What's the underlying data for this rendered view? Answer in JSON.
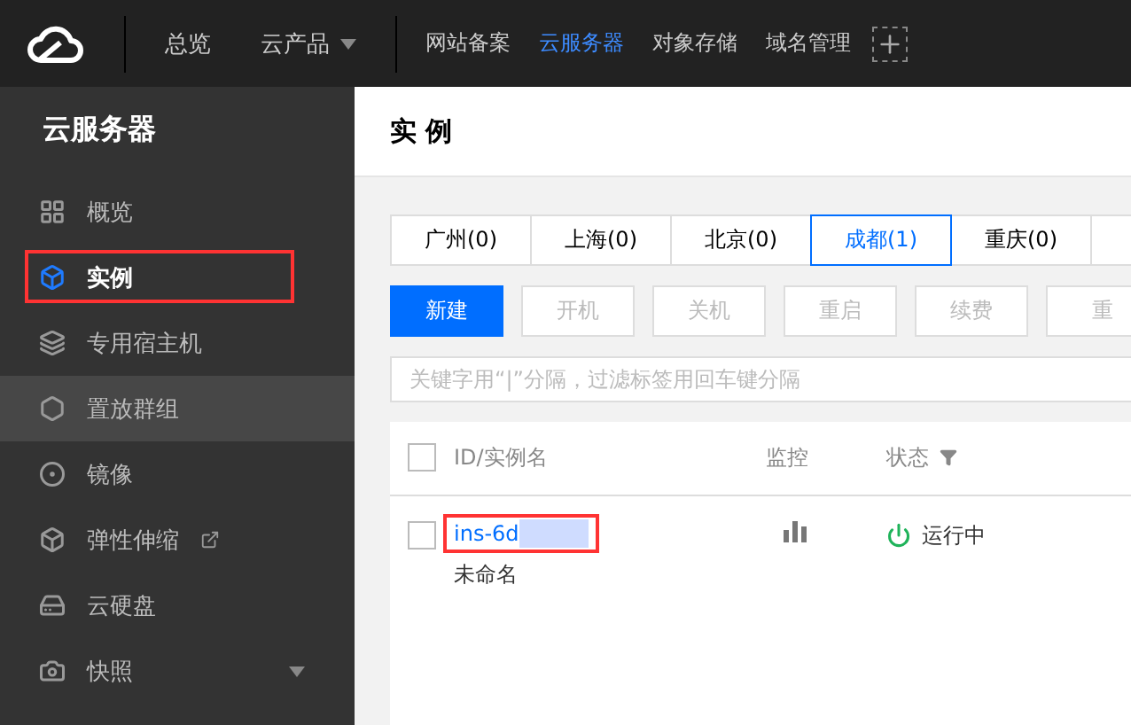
{
  "top_nav": {
    "items": [
      {
        "label": "总览",
        "dropdown": false
      },
      {
        "label": "云产品",
        "dropdown": true
      }
    ],
    "links": [
      {
        "label": "网站备案",
        "selected": false
      },
      {
        "label": "云服务器",
        "selected": true
      },
      {
        "label": "对象存储",
        "selected": false
      },
      {
        "label": "域名管理",
        "selected": false
      }
    ]
  },
  "sidebar": {
    "title": "云服务器",
    "items": [
      {
        "label": "概览",
        "kind": "grid",
        "selected": false,
        "hovered": false,
        "highlighted": false,
        "external": false,
        "expandable": false
      },
      {
        "label": "实例",
        "kind": "cube",
        "selected": true,
        "hovered": false,
        "highlighted": true,
        "external": false,
        "expandable": false
      },
      {
        "label": "专用宿主机",
        "kind": "layers",
        "selected": false,
        "hovered": false,
        "highlighted": false,
        "external": false,
        "expandable": false
      },
      {
        "label": "置放群组",
        "kind": "hexagon",
        "selected": false,
        "hovered": true,
        "highlighted": false,
        "external": false,
        "expandable": false
      },
      {
        "label": "镜像",
        "kind": "disc",
        "selected": false,
        "hovered": false,
        "highlighted": false,
        "external": false,
        "expandable": false
      },
      {
        "label": "弹性伸缩",
        "kind": "box",
        "selected": false,
        "hovered": false,
        "highlighted": false,
        "external": true,
        "expandable": false
      },
      {
        "label": "云硬盘",
        "kind": "drive",
        "selected": false,
        "hovered": false,
        "highlighted": false,
        "external": false,
        "expandable": false
      },
      {
        "label": "快照",
        "kind": "camera",
        "selected": false,
        "hovered": false,
        "highlighted": false,
        "external": false,
        "expandable": true
      }
    ]
  },
  "page_title": "实 例",
  "region_tabs": [
    {
      "label": "广州(0)",
      "selected": false
    },
    {
      "label": "上海(0)",
      "selected": false
    },
    {
      "label": "北京(0)",
      "selected": false
    },
    {
      "label": "成都(1)",
      "selected": true
    },
    {
      "label": "重庆(0)",
      "selected": false
    }
  ],
  "actions": [
    {
      "label": "新建",
      "primary": true
    },
    {
      "label": "开机",
      "primary": false
    },
    {
      "label": "关机",
      "primary": false
    },
    {
      "label": "重启",
      "primary": false
    },
    {
      "label": "续费",
      "primary": false
    },
    {
      "label": "重",
      "primary": false
    }
  ],
  "search": {
    "placeholder": "关键字用“|”分隔，过滤标签用回车键分隔"
  },
  "table": {
    "all_checked": false,
    "columns": [
      "ID/实例名",
      "监控",
      "状态"
    ],
    "rows": [
      {
        "id": "ins-6d",
        "name": "未命名",
        "status": "运行中",
        "checked": false,
        "highlighted": true,
        "redacted": true
      }
    ]
  }
}
